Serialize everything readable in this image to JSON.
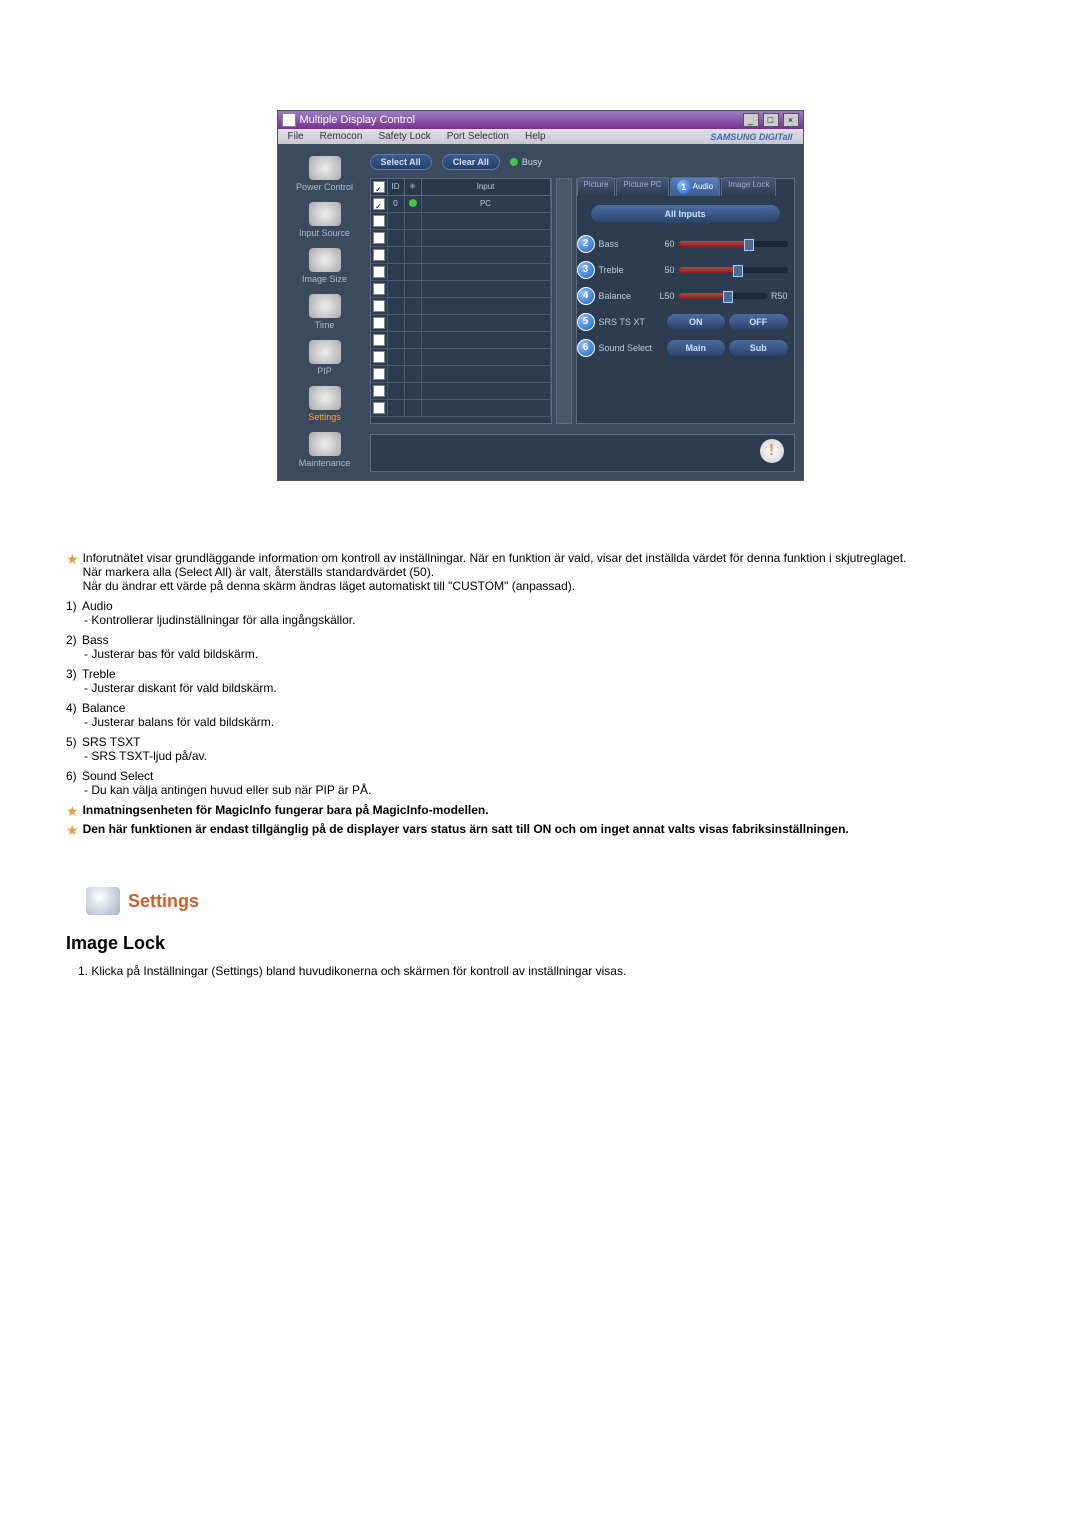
{
  "window": {
    "title": "Multiple Display Control",
    "brand": "SAMSUNG DIGITall"
  },
  "menu": {
    "file": "File",
    "remocon": "Remocon",
    "safety": "Safety Lock",
    "port": "Port Selection",
    "help": "Help"
  },
  "sidebar": {
    "items": [
      {
        "label": "Power Control"
      },
      {
        "label": "Input Source"
      },
      {
        "label": "Image Size"
      },
      {
        "label": "Time"
      },
      {
        "label": "PIP"
      },
      {
        "label": "Settings"
      },
      {
        "label": "Maintenance"
      }
    ]
  },
  "toolbar": {
    "select_all": "Select All",
    "clear_all": "Clear All",
    "busy": "Busy"
  },
  "grid": {
    "headers": {
      "id": "ID",
      "input": "Input"
    },
    "first_row": {
      "id": "0",
      "input": "PC"
    }
  },
  "panel": {
    "tabs": {
      "picture": "Picture",
      "picture_pc": "Picture PC",
      "number": "1",
      "audio": "Audio",
      "image_lock": "Image Lock"
    },
    "all_inputs": "All Inputs",
    "controls": {
      "bass": {
        "num": "2",
        "label": "Bass",
        "value": "60"
      },
      "treble": {
        "num": "3",
        "label": "Treble",
        "value": "50"
      },
      "balance": {
        "num": "4",
        "label": "Balance",
        "value_l": "L50",
        "value_r": "R50"
      }
    },
    "srs": {
      "num": "5",
      "label": "SRS TS XT",
      "on": "ON",
      "off": "OFF"
    },
    "sound_select": {
      "num": "6",
      "label": "Sound Select",
      "main": "Main",
      "sub": "Sub"
    }
  },
  "doc": {
    "p1": "Inforutnätet visar grundläggande information om kontroll av inställningar. När en funktion är vald, visar det inställda värdet för denna funktion i skjutreglaget.",
    "p1b": "När markera alla (Select All) är valt, återställs standardvärdet (50).",
    "p1c": "När du ändrar ett värde på denna skärm ändras läget automatiskt till \"CUSTOM\" (anpassad).",
    "l1": "Audio",
    "l1d": "- Kontrollerar ljudinställningar för alla ingångskällor.",
    "l2": "Bass",
    "l2d": "- Justerar bas för vald bildskärm.",
    "l3": "Treble",
    "l3d": "- Justerar diskant för vald bildskärm.",
    "l4": "Balance",
    "l4d": "- Justerar balans för vald bildskärm.",
    "l5": "SRS TSXT",
    "l5d": "- SRS TSXT-ljud på/av.",
    "l6": "Sound Select",
    "l6d": "- Du kan välja antingen huvud eller sub när PIP är PÅ.",
    "note1": "Inmatningsenheten för MagicInfo fungerar bara på MagicInfo-modellen.",
    "note2": "Den här funktionen är endast tillgänglig på de displayer vars status ärn satt till ON och om inget annat valts visas fabriksinställningen."
  },
  "section": {
    "settings": "Settings",
    "image_lock": "Image Lock",
    "step1": "1. Klicka på Inställningar (Settings) bland huvudikonerna och skärmen för kontroll av inställningar visas."
  }
}
